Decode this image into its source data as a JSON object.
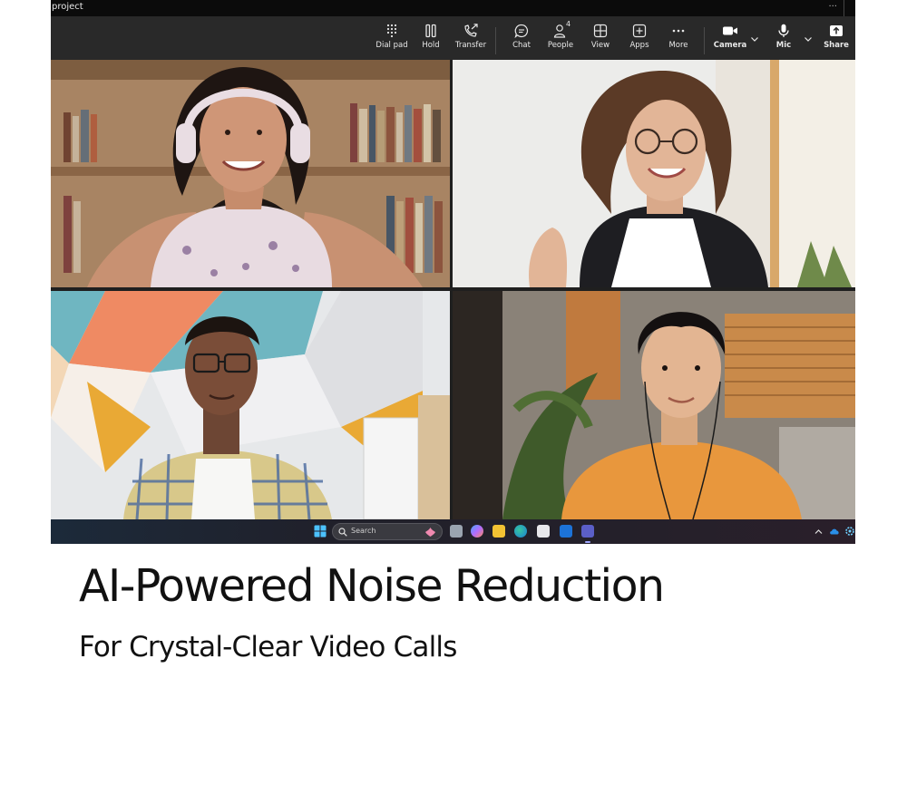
{
  "window": {
    "title": "project",
    "overflow_icon": "more-dots-icon"
  },
  "toolbar": {
    "dialpad_label": "Dial pad",
    "hold_label": "Hold",
    "transfer_label": "Transfer",
    "chat_label": "Chat",
    "people_label": "People",
    "people_count": "4",
    "view_label": "View",
    "apps_label": "Apps",
    "more_label": "More",
    "camera_label": "Camera",
    "mic_label": "Mic",
    "share_label": "Share"
  },
  "participants": [
    {
      "description": "woman-with-headphones"
    },
    {
      "description": "woman-with-glasses"
    },
    {
      "description": "man-with-glasses"
    },
    {
      "description": "man-with-earphones"
    }
  ],
  "taskbar": {
    "search_placeholder": "Search",
    "apps": [
      "windows-start-icon",
      "search-icon",
      "copilot-icon",
      "task-view-icon",
      "file-explorer-icon",
      "edge-icon",
      "store-icon",
      "outlook-icon",
      "teams-icon"
    ],
    "tray": [
      "chevron-up-icon",
      "onedrive-icon",
      "settings-icon"
    ]
  },
  "marketing": {
    "headline": "AI-Powered Noise Reduction",
    "subheadline": "For Crystal-Clear Video Calls"
  },
  "colors": {
    "toolbar_bg": "#292929",
    "titlebar_bg": "#0b0b0b",
    "text_dark": "#111111"
  }
}
